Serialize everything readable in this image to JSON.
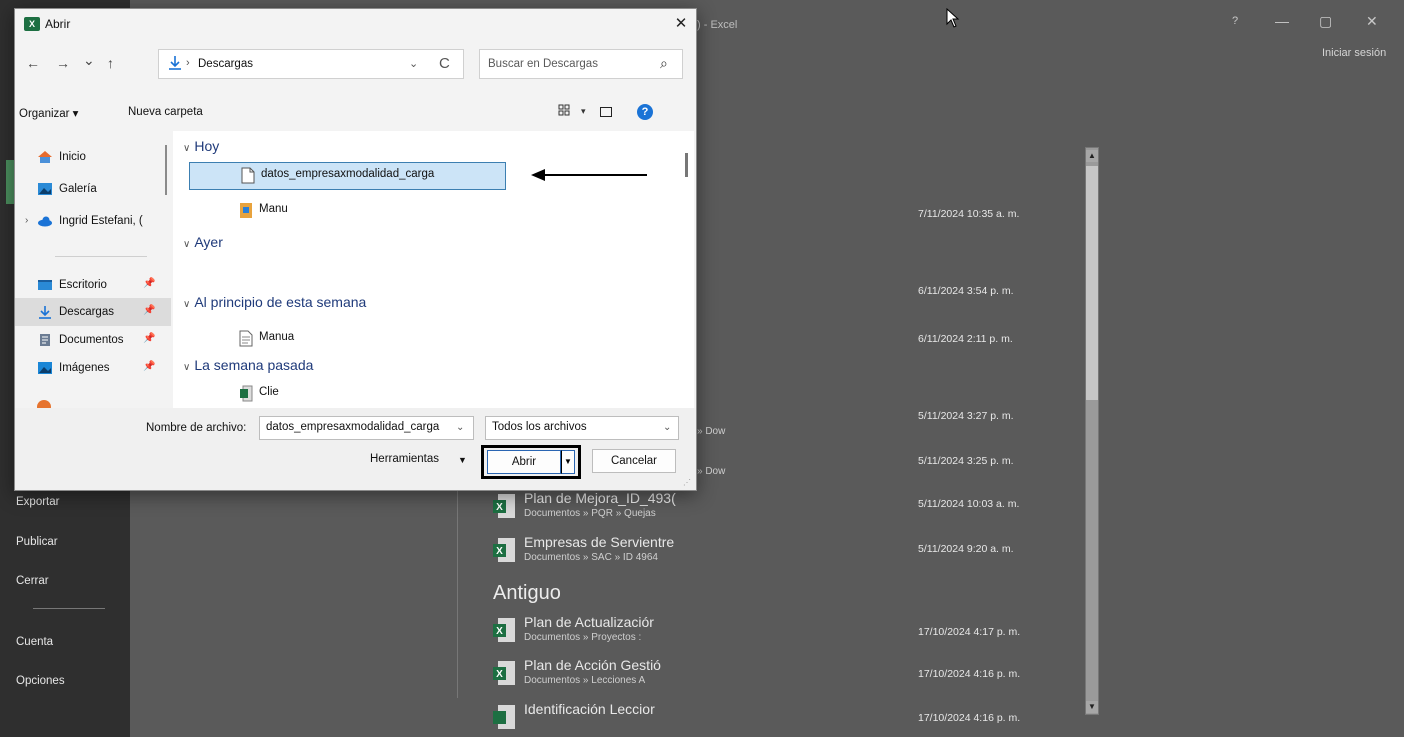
{
  "excel": {
    "title_fragment": ") - Excel",
    "window_controls": [
      "?",
      "—",
      "▢",
      "✕"
    ],
    "sign_in": "Iniciar sesión",
    "side_items": [
      {
        "label": "Exportar"
      },
      {
        "label": "Publicar"
      },
      {
        "label": "Cerrar"
      },
      {
        "label": "Cuenta"
      },
      {
        "label": "Opciones"
      }
    ],
    "section_antiguo": "Antiguo",
    "path_fragments": [
      "» Dow",
      "» Dow"
    ],
    "dates_upper": [
      "7/11/2024 10:35 a. m.",
      "6/11/2024 3:54 p. m.",
      "6/11/2024 2:11 p. m.",
      "5/11/2024 3:27 p. m.",
      "5/11/2024 3:25 p. m."
    ],
    "recent_files": [
      {
        "name": "Plan de Mejora_ID_493(",
        "path": "Documentos » PQR » Quejas",
        "date": "5/11/2024 10:03 a. m."
      },
      {
        "name": "Empresas de Servientre",
        "path": "Documentos » SAC » ID 4964",
        "date": "5/11/2024 9:20 a. m."
      },
      {
        "name": "Plan de Actualizaciór",
        "path": "Documentos » Proyectos :",
        "date": "17/10/2024 4:17 p. m."
      },
      {
        "name": "Plan de Acción Gestió",
        "path": "Documentos » Lecciones A",
        "date": "17/10/2024 4:16 p. m."
      },
      {
        "name": "Identificación Leccior",
        "path": "",
        "date": "17/10/2024 4:16 p. m."
      }
    ]
  },
  "dialog": {
    "title": "Abrir",
    "close": "✕",
    "nav": {
      "back": "←",
      "forward": "→",
      "recent": "⌄",
      "up": "↑"
    },
    "address": {
      "sep": "›",
      "folder": "Descargas",
      "dropdown": "⌄",
      "refresh": "C"
    },
    "search": {
      "placeholder": "Buscar en Descargas",
      "icon": "⌕"
    },
    "toolbar": {
      "organize": "Organizar ▾",
      "new_folder": "Nueva carpeta",
      "view_dd": "▾",
      "help": "?"
    },
    "nav_items": [
      {
        "label": "Inicio",
        "icon": "home-icon"
      },
      {
        "label": "Galería",
        "icon": "gallery-icon"
      },
      {
        "label": "Ingrid Estefani, (",
        "icon": "onedrive-icon"
      },
      {
        "label": "Escritorio",
        "icon": "desktop-icon"
      },
      {
        "label": "Descargas",
        "icon": "downloads-icon"
      },
      {
        "label": "Documentos",
        "icon": "documents-icon"
      },
      {
        "label": "Imágenes",
        "icon": "images-icon"
      }
    ],
    "groups": [
      {
        "label": "Hoy"
      },
      {
        "label": "Ayer"
      },
      {
        "label": "Al principio de esta semana"
      },
      {
        "label": "La semana pasada"
      }
    ],
    "files": [
      {
        "name": "datos_empresaxmodalidad_carga",
        "icon": "file-icon",
        "selected": true
      },
      {
        "name": "Manu",
        "icon": "pdf-file-icon"
      },
      {
        "name": "Manua",
        "icon": "text-file-icon"
      },
      {
        "name": "Clie",
        "icon": "excel-file-icon"
      }
    ],
    "filename_label": "Nombre de archivo:",
    "filename_value": "datos_empresaxmodalidad_carga",
    "filetype": "Todos los archivos",
    "tools": "Herramientas",
    "open": "Abrir",
    "cancel": "Cancelar",
    "dd": "⌄"
  },
  "colors": {
    "excel_green": "#1d6f42",
    "selection": "#cce4f7",
    "accent_blue": "#1a73d6"
  }
}
